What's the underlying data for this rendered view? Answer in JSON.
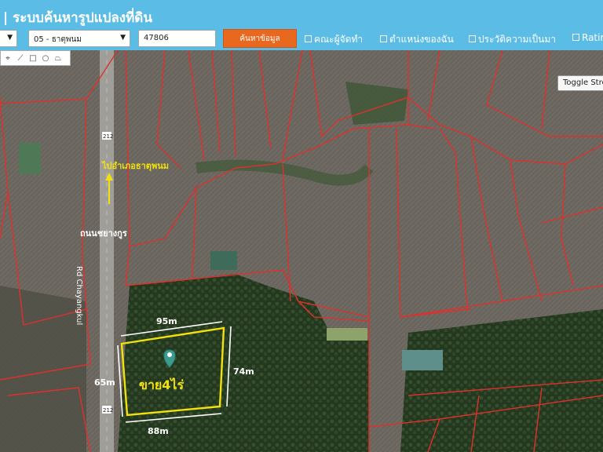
{
  "header": {
    "title": "| ระบบค้นหารูปแปลงที่ดิน",
    "province_select": "",
    "district_select": "05 - ธาตุพนม",
    "parcel_input": "47806",
    "search_button": "ค้นหาข้อมูล",
    "checkboxes": [
      "คณะผู้จัดทำ",
      "ตำแหน่งของฉัน",
      "ประวัติความเป็นมา",
      "Ratin"
    ]
  },
  "map": {
    "toggle_button": "Toggle Street",
    "direction_label": "ไปอำเภอธาตุพนม",
    "road_name_thai": "ถนนชยางกูร",
    "road_name_latin": "Rd Chayangkul",
    "road_number_top": "212",
    "road_number_bottom": "212",
    "edge_top": "95m",
    "edge_left": "65m",
    "edge_right": "74m",
    "edge_bottom": "88m",
    "sale_label": "ขาย4ไร่",
    "colors": {
      "parcel_line": "#e0302c",
      "plot_outline": "#f2e10f",
      "annotation": "#ffffff",
      "header_bg": "#5bbde6",
      "search_button": "#e8681f"
    }
  }
}
